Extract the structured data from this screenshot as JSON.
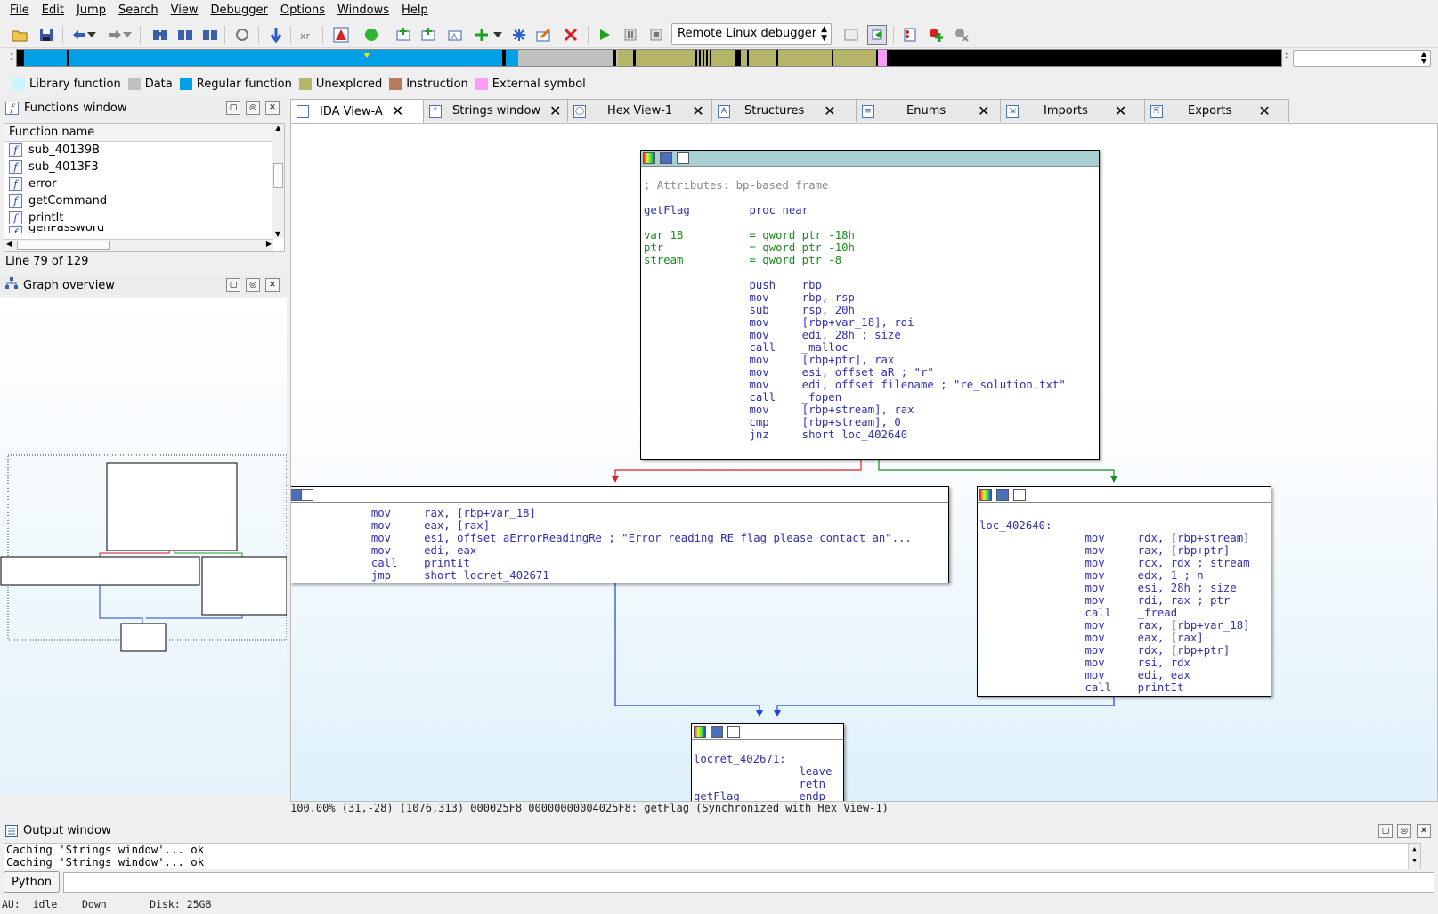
{
  "menu": [
    "File",
    "Edit",
    "Jump",
    "Search",
    "View",
    "Debugger",
    "Options",
    "Windows",
    "Help"
  ],
  "toolbar": {
    "debugger_select": "Remote Linux debugger"
  },
  "legend": [
    {
      "label": "Library function",
      "color": "#c8f6ff"
    },
    {
      "label": "Data",
      "color": "#c0c0c0"
    },
    {
      "label": "Regular function",
      "color": "#00a0e6"
    },
    {
      "label": "Unexplored",
      "color": "#b5b56a"
    },
    {
      "label": "Instruction",
      "color": "#b87a5a"
    },
    {
      "label": "External symbol",
      "color": "#ff9cf5"
    }
  ],
  "functions_window": {
    "title": "Functions window",
    "column": "Function name",
    "items": [
      "sub_40139B",
      "sub_4013F3",
      "error",
      "getCommand",
      "printIt",
      "genPassword"
    ],
    "line_status": "Line 79 of 129"
  },
  "graph_overview": {
    "title": "Graph overview"
  },
  "tabs": [
    "IDA View-A",
    "Strings window",
    "Hex View-1",
    "Structures",
    "Enums",
    "Imports",
    "Exports"
  ],
  "tab_icons": [
    "page",
    "str",
    "hex",
    "A",
    "enum",
    "imp",
    "exp"
  ],
  "node_main": {
    "lines": [
      {
        "t": ""
      },
      {
        "t": "; Attributes: bp-based frame",
        "c": "c-cmt"
      },
      {
        "t": ""
      },
      {
        "t": "getFlag         proc near",
        "c": "c-lbl"
      },
      {
        "t": ""
      },
      {
        "t": "var_18          = qword ptr -18h",
        "c": "c-grn"
      },
      {
        "t": "ptr             = qword ptr -10h",
        "c": "c-grn"
      },
      {
        "t": "stream          = qword ptr -8",
        "c": "c-grn"
      },
      {
        "t": ""
      },
      {
        "t": "                push    rbp",
        "c": "c-mn"
      },
      {
        "t": "                mov     rbp, rsp",
        "c": "c-mn"
      },
      {
        "t": "                sub     rsp, 20h",
        "c": "c-mn"
      },
      {
        "t": "                mov     [rbp+var_18], rdi",
        "c": "c-mn"
      },
      {
        "t": "                mov     edi, 28h ; size",
        "c": "c-mn"
      },
      {
        "t": "                call    _malloc",
        "c": "c-mn"
      },
      {
        "t": "                mov     [rbp+ptr], rax",
        "c": "c-mn"
      },
      {
        "t": "                mov     esi, offset aR ; \"r\"",
        "c": "c-mn"
      },
      {
        "t": "                mov     edi, offset filename ; \"re_solution.txt\"",
        "c": "c-mn"
      },
      {
        "t": "                call    _fopen",
        "c": "c-mn"
      },
      {
        "t": "                mov     [rbp+stream], rax",
        "c": "c-mn"
      },
      {
        "t": "                cmp     [rbp+stream], 0",
        "c": "c-mn"
      },
      {
        "t": "                jnz     short loc_402640",
        "c": "c-mn"
      }
    ]
  },
  "node_left": {
    "lines": [
      {
        "t": "            mov     rax, [rbp+var_18]"
      },
      {
        "t": "            mov     eax, [rax]"
      },
      {
        "t": "            mov     esi, offset aErrorReadingRe ; \"Error reading RE flag please contact an\"..."
      },
      {
        "t": "            mov     edi, eax"
      },
      {
        "t": "            call    printIt"
      },
      {
        "t": "            jmp     short locret_402671"
      }
    ]
  },
  "node_right": {
    "lines": [
      {
        "t": "loc_402640:"
      },
      {
        "t": "                mov     rdx, [rbp+stream]"
      },
      {
        "t": "                mov     rax, [rbp+ptr]"
      },
      {
        "t": "                mov     rcx, rdx ; stream"
      },
      {
        "t": "                mov     edx, 1 ; n"
      },
      {
        "t": "                mov     esi, 28h ; size"
      },
      {
        "t": "                mov     rdi, rax ; ptr"
      },
      {
        "t": "                call    _fread"
      },
      {
        "t": "                mov     rax, [rbp+var_18]"
      },
      {
        "t": "                mov     eax, [rax]"
      },
      {
        "t": "                mov     rdx, [rbp+ptr]"
      },
      {
        "t": "                mov     rsi, rdx"
      },
      {
        "t": "                mov     edi, eax"
      },
      {
        "t": "                call    printIt"
      }
    ]
  },
  "node_bottom": {
    "lines": [
      {
        "t": ""
      },
      {
        "t": "locret_402671:"
      },
      {
        "t": "                leave"
      },
      {
        "t": "                retn"
      },
      {
        "t": "getFlag         endp"
      }
    ]
  },
  "graph_status": "100.00% (31,-28) (1076,313) 000025F8 00000000004025F8: getFlag (Synchronized with Hex View-1)",
  "output_window": {
    "title": "Output window",
    "lines": [
      "Caching 'Strings window'... ok",
      "Caching 'Strings window'... ok"
    ],
    "python_button": "Python"
  },
  "statusbar": "AU:  idle    Down       Disk: 25GB"
}
